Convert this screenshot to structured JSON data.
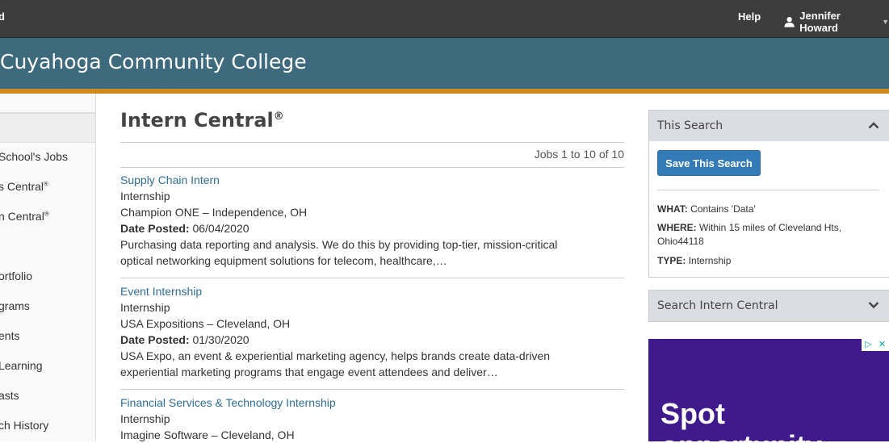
{
  "topbar": {
    "left_fragment": "d",
    "help": "Help",
    "user_name": "Jennifer Howard"
  },
  "banner": {
    "title": "Cuyahoga Community College"
  },
  "sidebar": {
    "items": [
      {
        "label": "School's Jobs",
        "sup": ""
      },
      {
        "label": "s Central",
        "sup": "®"
      },
      {
        "label": "n Central",
        "sup": "®"
      },
      {
        "label": "ortfolio",
        "sup": ""
      },
      {
        "label": "grams",
        "sup": ""
      },
      {
        "label": "ents",
        "sup": ""
      },
      {
        "label": "Learning",
        "sup": ""
      },
      {
        "label": "asts",
        "sup": ""
      },
      {
        "label": "ch History",
        "sup": ""
      }
    ]
  },
  "main": {
    "title": "Intern Central",
    "title_sup": "®",
    "count": "Jobs 1 to 10 of 10",
    "jobs": [
      {
        "title": "Supply Chain Intern",
        "type": "Internship",
        "company": "Champion ONE – Independence, OH",
        "date_label": "Date Posted:",
        "date": "06/04/2020",
        "desc1": "Purchasing data reporting and analysis. We do this by providing top-tier, mission-critical",
        "desc2": "optical networking equipment solutions for telecom, healthcare,…"
      },
      {
        "title": "Event Internship",
        "type": "Internship",
        "company": "USA Expositions – Cleveland, OH",
        "date_label": "Date Posted:",
        "date": "01/30/2020",
        "desc1": "USA Expo, an event & experiential marketing agency, helps brands create data-driven",
        "desc2": "experiential marketing programs that engage event attendees and deliver…"
      },
      {
        "title": "Financial Services & Technology Internship",
        "type": "Internship",
        "company": "Imagine Software – Cleveland, OH"
      }
    ]
  },
  "this_search": {
    "header": "This Search",
    "save_button": "Save This Search",
    "what_label": "WHAT:",
    "what_value": "Contains 'Data'",
    "where_label": "WHERE:",
    "where_value_1": "Within 15 miles of Cleveland Hts,",
    "where_value_2": "Ohio44118",
    "type_label": "TYPE:",
    "type_value": "Internship"
  },
  "search_panel": {
    "header": "Search Intern Central"
  },
  "ad": {
    "line1": "Spot",
    "line2": "opportunity"
  },
  "colors": {
    "topbar": "#3d3d3d",
    "banner": "#3e6a7e",
    "accent_stripe": "#d08a1c",
    "link": "#2f6d95",
    "button": "#337ab7",
    "ad_bg": "#3f1a8c"
  }
}
